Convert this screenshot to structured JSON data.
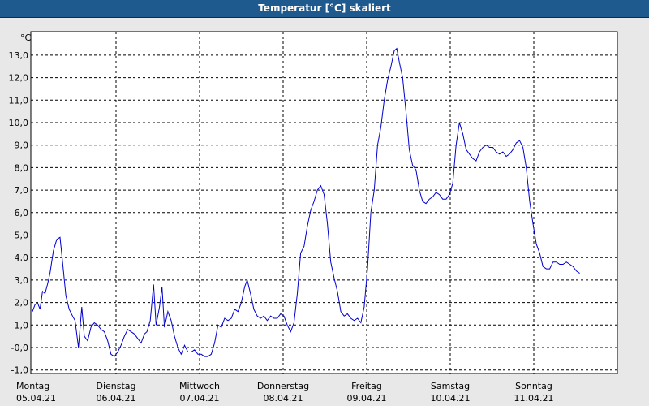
{
  "chart_data": {
    "type": "line",
    "title": "Temperatur [°C] skaliert",
    "unit_label": "°C",
    "ylim": [
      -1.0,
      14.0
    ],
    "y_ticks": [
      "13,0",
      "12,0",
      "11,0",
      "10,0",
      "9,0",
      "8,0",
      "7,0",
      "6,0",
      "5,0",
      "4,0",
      "3,0",
      "2,0",
      "1,0",
      "-0,0",
      "-1,0"
    ],
    "x_days": [
      {
        "day": "Montag",
        "date": "05.04.21"
      },
      {
        "day": "Dienstag",
        "date": "06.04.21"
      },
      {
        "day": "Mittwoch",
        "date": "07.04.21"
      },
      {
        "day": "Donnerstag",
        "date": "08.04.21"
      },
      {
        "day": "Freitag",
        "date": "09.04.21"
      },
      {
        "day": "Samstag",
        "date": "10.04.21"
      },
      {
        "day": "Sonntag",
        "date": "11.04.21"
      }
    ],
    "grid": true,
    "line_color": "#0000cc",
    "series": [
      {
        "values": [
          [
            0.0,
            1.6
          ],
          [
            0.03,
            1.9
          ],
          [
            0.06,
            2.0
          ],
          [
            0.09,
            1.7
          ],
          [
            0.12,
            2.5
          ],
          [
            0.15,
            2.4
          ],
          [
            0.18,
            2.8
          ],
          [
            0.21,
            3.3
          ],
          [
            0.25,
            4.3
          ],
          [
            0.29,
            4.8
          ],
          [
            0.33,
            4.9
          ],
          [
            0.36,
            3.8
          ],
          [
            0.4,
            2.3
          ],
          [
            0.44,
            1.7
          ],
          [
            0.48,
            1.4
          ],
          [
            0.51,
            1.2
          ],
          [
            0.55,
            0.0
          ],
          [
            0.59,
            1.8
          ],
          [
            0.62,
            0.5
          ],
          [
            0.66,
            0.3
          ],
          [
            0.7,
            0.9
          ],
          [
            0.74,
            1.1
          ],
          [
            0.78,
            1.0
          ],
          [
            0.82,
            0.8
          ],
          [
            0.86,
            0.7
          ],
          [
            0.9,
            0.3
          ],
          [
            0.94,
            -0.3
          ],
          [
            0.98,
            -0.4
          ],
          [
            1.02,
            -0.2
          ],
          [
            1.06,
            0.1
          ],
          [
            1.1,
            0.5
          ],
          [
            1.14,
            0.8
          ],
          [
            1.18,
            0.7
          ],
          [
            1.22,
            0.6
          ],
          [
            1.26,
            0.4
          ],
          [
            1.3,
            0.2
          ],
          [
            1.34,
            0.6
          ],
          [
            1.37,
            0.7
          ],
          [
            1.41,
            1.2
          ],
          [
            1.45,
            2.8
          ],
          [
            1.48,
            1.0
          ],
          [
            1.52,
            1.8
          ],
          [
            1.55,
            2.7
          ],
          [
            1.58,
            0.9
          ],
          [
            1.62,
            1.6
          ],
          [
            1.66,
            1.2
          ],
          [
            1.7,
            0.5
          ],
          [
            1.74,
            0.0
          ],
          [
            1.78,
            -0.3
          ],
          [
            1.82,
            0.1
          ],
          [
            1.86,
            -0.2
          ],
          [
            1.9,
            -0.2
          ],
          [
            1.94,
            -0.1
          ],
          [
            1.98,
            -0.3
          ],
          [
            2.02,
            -0.3
          ],
          [
            2.06,
            -0.4
          ],
          [
            2.1,
            -0.4
          ],
          [
            2.14,
            -0.3
          ],
          [
            2.18,
            0.2
          ],
          [
            2.22,
            1.0
          ],
          [
            2.26,
            0.9
          ],
          [
            2.3,
            1.3
          ],
          [
            2.34,
            1.2
          ],
          [
            2.38,
            1.3
          ],
          [
            2.42,
            1.7
          ],
          [
            2.46,
            1.6
          ],
          [
            2.5,
            2.0
          ],
          [
            2.54,
            2.7
          ],
          [
            2.57,
            3.0
          ],
          [
            2.61,
            2.4
          ],
          [
            2.65,
            1.7
          ],
          [
            2.69,
            1.4
          ],
          [
            2.73,
            1.3
          ],
          [
            2.77,
            1.4
          ],
          [
            2.81,
            1.2
          ],
          [
            2.85,
            1.4
          ],
          [
            2.89,
            1.3
          ],
          [
            2.93,
            1.3
          ],
          [
            2.97,
            1.5
          ],
          [
            3.01,
            1.4
          ],
          [
            3.05,
            1.0
          ],
          [
            3.09,
            0.7
          ],
          [
            3.13,
            1.1
          ],
          [
            3.17,
            2.4
          ],
          [
            3.21,
            4.2
          ],
          [
            3.25,
            4.5
          ],
          [
            3.29,
            5.4
          ],
          [
            3.33,
            6.1
          ],
          [
            3.37,
            6.5
          ],
          [
            3.41,
            7.0
          ],
          [
            3.45,
            7.2
          ],
          [
            3.49,
            6.8
          ],
          [
            3.53,
            5.5
          ],
          [
            3.57,
            3.8
          ],
          [
            3.61,
            3.1
          ],
          [
            3.65,
            2.5
          ],
          [
            3.69,
            1.6
          ],
          [
            3.73,
            1.4
          ],
          [
            3.77,
            1.5
          ],
          [
            3.81,
            1.3
          ],
          [
            3.85,
            1.2
          ],
          [
            3.89,
            1.3
          ],
          [
            3.93,
            1.1
          ],
          [
            3.97,
            1.8
          ],
          [
            4.01,
            3.5
          ],
          [
            4.05,
            6.0
          ],
          [
            4.09,
            7.0
          ],
          [
            4.13,
            9.0
          ],
          [
            4.17,
            9.8
          ],
          [
            4.21,
            11.0
          ],
          [
            4.25,
            11.9
          ],
          [
            4.29,
            12.5
          ],
          [
            4.33,
            13.2
          ],
          [
            4.36,
            13.3
          ],
          [
            4.39,
            12.7
          ],
          [
            4.43,
            12.0
          ],
          [
            4.47,
            10.5
          ],
          [
            4.51,
            8.8
          ],
          [
            4.55,
            8.1
          ],
          [
            4.59,
            7.9
          ],
          [
            4.63,
            7.0
          ],
          [
            4.67,
            6.5
          ],
          [
            4.71,
            6.4
          ],
          [
            4.75,
            6.6
          ],
          [
            4.79,
            6.7
          ],
          [
            4.83,
            6.9
          ],
          [
            4.87,
            6.8
          ],
          [
            4.91,
            6.6
          ],
          [
            4.95,
            6.6
          ],
          [
            4.99,
            6.8
          ],
          [
            5.03,
            7.3
          ],
          [
            5.07,
            9.0
          ],
          [
            5.11,
            10.0
          ],
          [
            5.15,
            9.5
          ],
          [
            5.19,
            8.8
          ],
          [
            5.23,
            8.6
          ],
          [
            5.27,
            8.4
          ],
          [
            5.31,
            8.3
          ],
          [
            5.35,
            8.7
          ],
          [
            5.39,
            8.9
          ],
          [
            5.43,
            9.0
          ],
          [
            5.47,
            8.9
          ],
          [
            5.51,
            8.9
          ],
          [
            5.55,
            8.7
          ],
          [
            5.59,
            8.6
          ],
          [
            5.63,
            8.7
          ],
          [
            5.67,
            8.5
          ],
          [
            5.71,
            8.6
          ],
          [
            5.75,
            8.8
          ],
          [
            5.79,
            9.1
          ],
          [
            5.83,
            9.2
          ],
          [
            5.87,
            8.9
          ],
          [
            5.91,
            8.0
          ],
          [
            5.95,
            6.5
          ],
          [
            5.99,
            5.5
          ],
          [
            6.03,
            4.6
          ],
          [
            6.07,
            4.2
          ],
          [
            6.11,
            3.6
          ],
          [
            6.15,
            3.5
          ],
          [
            6.19,
            3.5
          ],
          [
            6.23,
            3.8
          ],
          [
            6.27,
            3.8
          ],
          [
            6.31,
            3.7
          ],
          [
            6.35,
            3.7
          ],
          [
            6.39,
            3.8
          ],
          [
            6.43,
            3.7
          ],
          [
            6.47,
            3.6
          ],
          [
            6.51,
            3.4
          ],
          [
            6.55,
            3.3
          ]
        ]
      }
    ]
  }
}
